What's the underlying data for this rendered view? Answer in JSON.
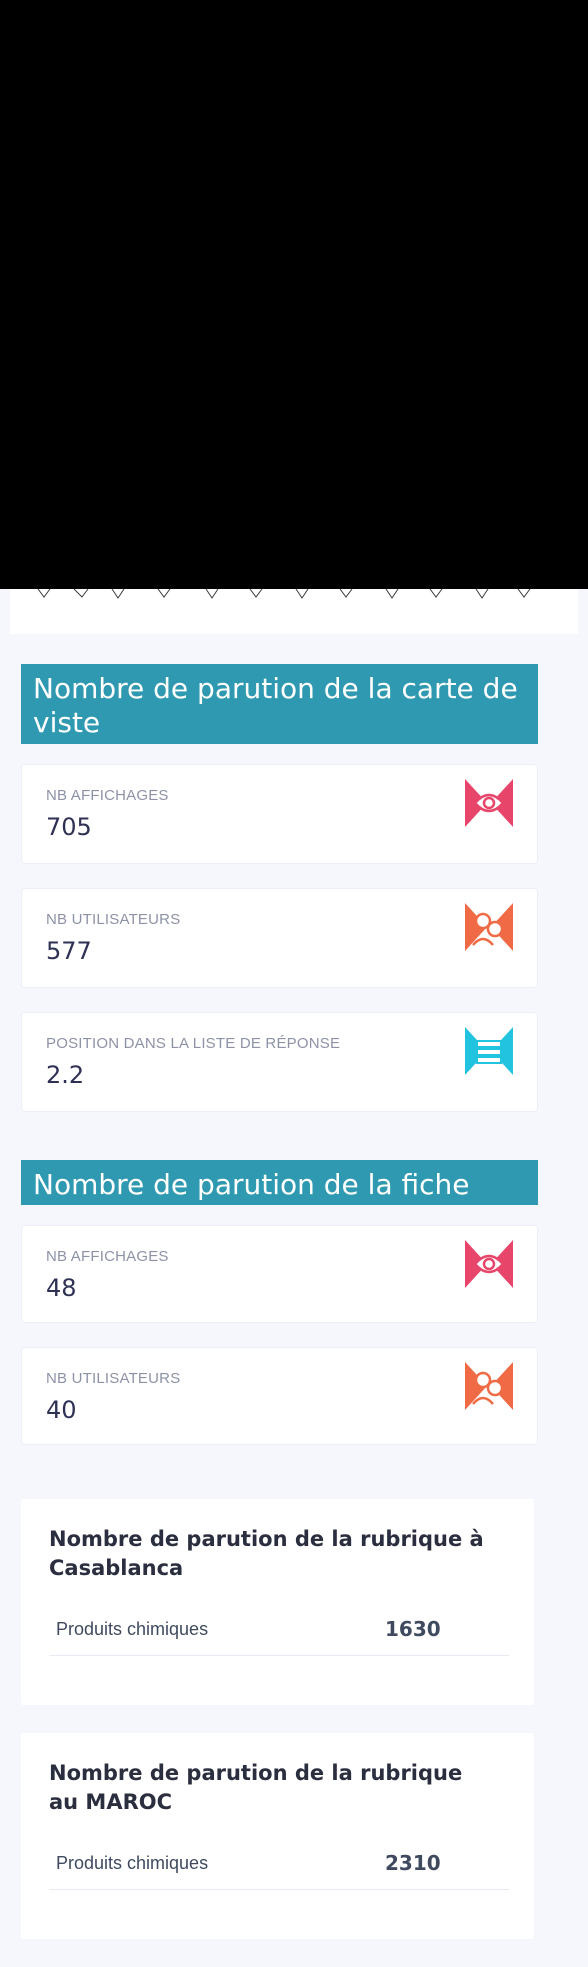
{
  "carte_section": {
    "title": "Nombre de parution de la carte de viste",
    "stats": [
      {
        "label": "NB AFFICHAGES",
        "value": "705",
        "icon": "eye-icon",
        "color": "#e8456b"
      },
      {
        "label": "NB UTILISATEURS",
        "value": "577",
        "icon": "users-icon",
        "color": "#f06a45"
      },
      {
        "label": "POSITION DANS LA LISTE DE RÉPONSE",
        "value": "2.2",
        "icon": "list-position-icon",
        "color": "#22c3df"
      }
    ]
  },
  "fiche_section": {
    "title": "Nombre de parution de la fiche",
    "stats": [
      {
        "label": "NB AFFICHAGES",
        "value": "48",
        "icon": "eye-icon",
        "color": "#e8456b"
      },
      {
        "label": "NB UTILISATEURS",
        "value": "40",
        "icon": "users-icon",
        "color": "#f06a45"
      }
    ]
  },
  "rubrique_casablanca": {
    "title": "Nombre de parution de la rubrique à Casablanca",
    "rows": [
      {
        "name": "Produits chimiques",
        "count": "1630"
      }
    ]
  },
  "rubrique_maroc": {
    "title": "Nombre de parution de la rubrique au MAROC",
    "rows": [
      {
        "name": "Produits chimiques",
        "count": "2310"
      }
    ]
  }
}
